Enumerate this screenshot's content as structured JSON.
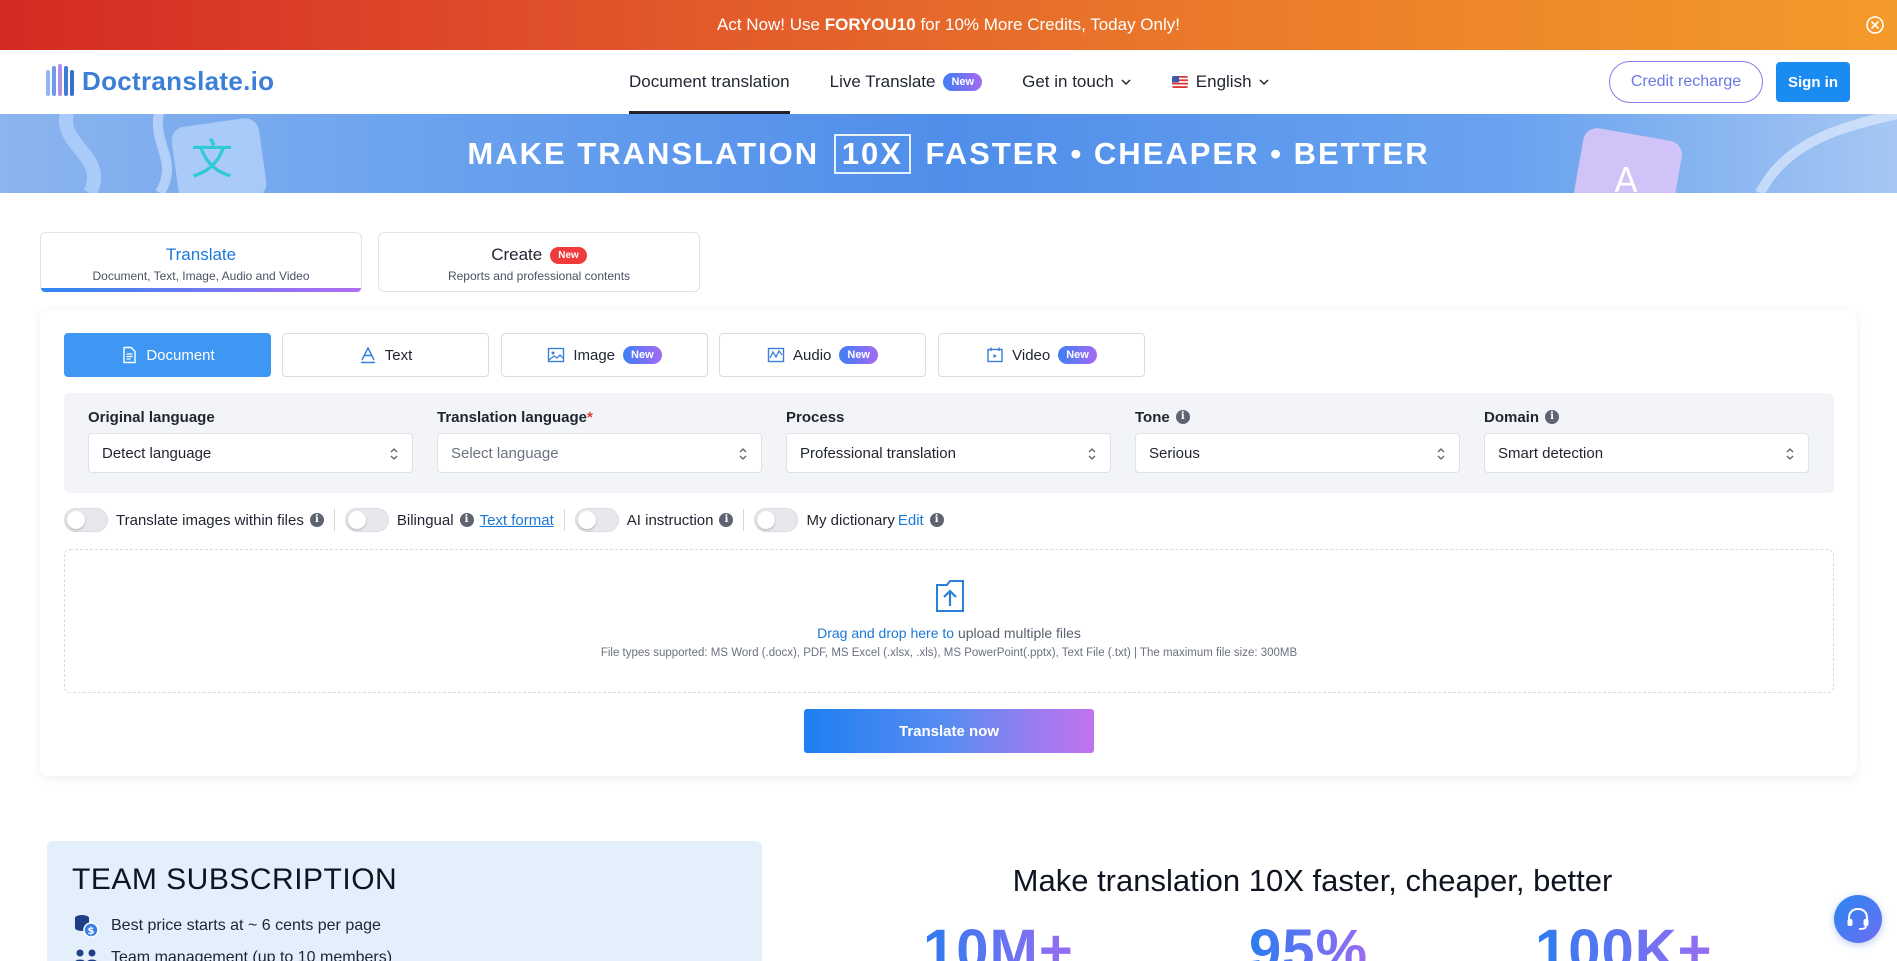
{
  "promo": {
    "prefix": "Act Now! Use ",
    "code": "FORYOU10",
    "suffix": " for 10% More Credits, Today Only!"
  },
  "header": {
    "logo_text": "Doctranslate.io",
    "nav": {
      "document_translation": "Document translation",
      "live_translate": "Live Translate",
      "live_badge": "New",
      "get_in_touch": "Get in touch",
      "language": "English"
    },
    "credit_recharge": "Credit recharge",
    "sign_in": "Sign in"
  },
  "banner": {
    "before": "MAKE TRANSLATION ",
    "boxed": "10X",
    "after": " FASTER • CHEAPER • BETTER"
  },
  "mode_tabs": {
    "translate": {
      "title": "Translate",
      "subtitle": "Document, Text, Image, Audio and Video"
    },
    "create": {
      "title": "Create",
      "badge": "New",
      "subtitle": "Reports and professional contents"
    }
  },
  "sub_tabs": {
    "document": "Document",
    "text": "Text",
    "image": "Image",
    "audio": "Audio",
    "video": "Video",
    "new_badge": "New"
  },
  "options": {
    "original_language": {
      "label": "Original language",
      "value": "Detect language"
    },
    "translation_language": {
      "label": "Translation language",
      "required_mark": "*",
      "placeholder": "Select language"
    },
    "process": {
      "label": "Process",
      "value": "Professional translation"
    },
    "tone": {
      "label": "Tone",
      "value": "Serious"
    },
    "domain": {
      "label": "Domain",
      "value": "Smart detection"
    }
  },
  "toggles": {
    "translate_images": "Translate images within files",
    "bilingual": "Bilingual",
    "text_format": "Text format",
    "ai_instruction": "AI instruction",
    "my_dictionary": "My dictionary",
    "edit": "Edit"
  },
  "upload": {
    "drag_text": "Drag and drop here to",
    "upload_text": " upload multiple files",
    "supported": "File types supported: MS Word (.docx), PDF, MS Excel (.xlsx, .xls), MS PowerPoint(.pptx), Text File (.txt) | The maximum file size: 300MB"
  },
  "translate_now": "Translate now",
  "team": {
    "title": "TEAM SUBSCRIPTION",
    "price_line": "Best price starts at ~ 6 cents per page",
    "team_line": "Team management (up to 10 members)"
  },
  "stats": {
    "title": "Make translation 10X faster, cheaper, better",
    "values": [
      "10M+",
      "95%",
      "100K+"
    ]
  },
  "colors": {
    "primary": "#1a8bf0",
    "active_tab": "#3e97f2",
    "link": "#1a78d8",
    "promo_start": "#d42a24",
    "promo_end": "#f49a2a"
  }
}
